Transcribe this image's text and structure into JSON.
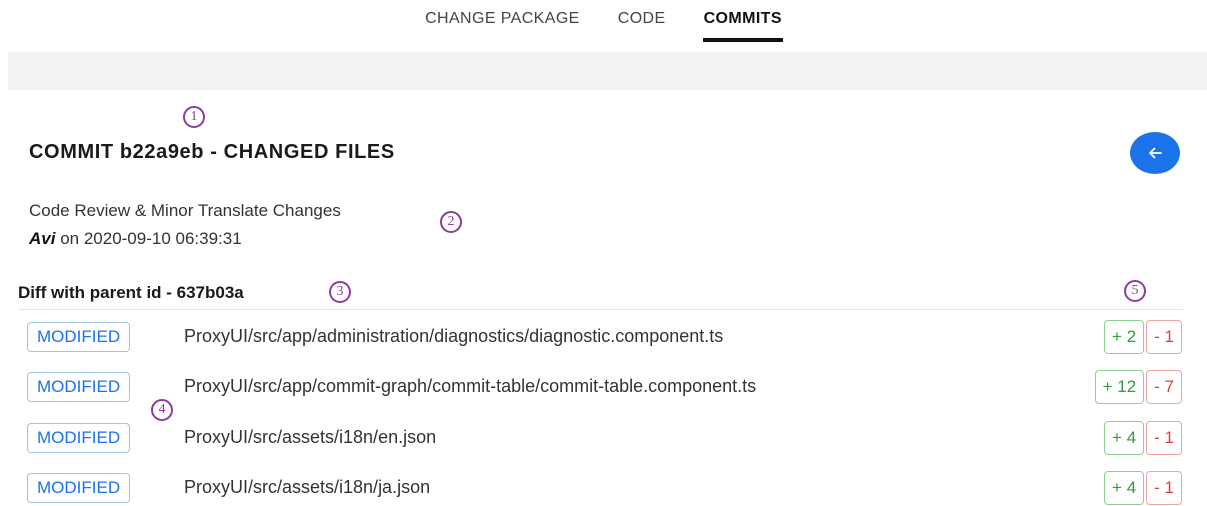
{
  "tabs": [
    {
      "label": "CHANGE PACKAGE",
      "active": false
    },
    {
      "label": "CODE",
      "active": false
    },
    {
      "label": "COMMITS",
      "active": true
    }
  ],
  "callouts": [
    "1",
    "2",
    "3",
    "4",
    "5"
  ],
  "commit": {
    "title": "COMMIT b22a9eb - CHANGED FILES",
    "message": "Code Review & Minor Translate Changes",
    "author": "Avi",
    "on_text": " on 2020-09-10 06:39:31"
  },
  "back_button_icon": "arrow-left-icon",
  "diff_header": "Diff with parent id - 637b03a",
  "files": [
    {
      "status": "MODIFIED",
      "path": "ProxyUI/src/app/administration/diagnostics/diagnostic.component.ts",
      "additions": "+ 2",
      "deletions": "- 1"
    },
    {
      "status": "MODIFIED",
      "path": "ProxyUI/src/app/commit-graph/commit-table/commit-table.component.ts",
      "additions": "+ 12",
      "deletions": "- 7"
    },
    {
      "status": "MODIFIED",
      "path": "ProxyUI/src/assets/i18n/en.json",
      "additions": "+ 4",
      "deletions": "- 1"
    },
    {
      "status": "MODIFIED",
      "path": "ProxyUI/src/assets/i18n/ja.json",
      "additions": "+ 4",
      "deletions": "- 1"
    }
  ],
  "colors": {
    "accent": "#1a73e8",
    "callout": "#8c3e9c",
    "add": "#2e9e3e",
    "delete": "#d9433f"
  }
}
